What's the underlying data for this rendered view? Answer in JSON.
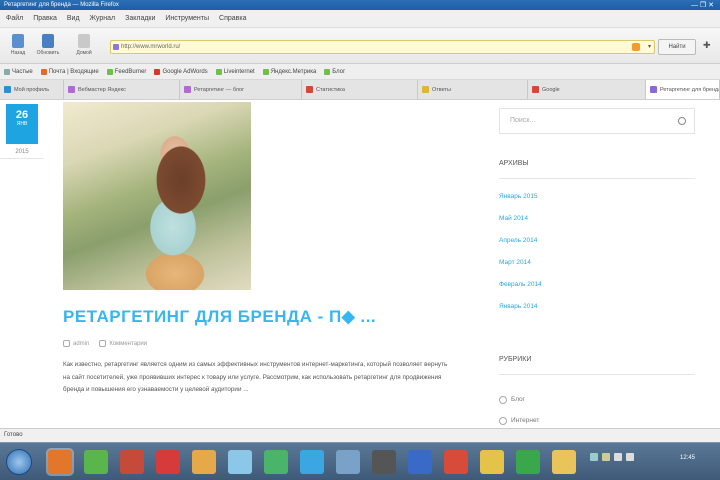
{
  "window": {
    "title": "Ретаргетинг для бренда — Mozilla Firefox",
    "controls": "— ❐ ✕"
  },
  "menu": [
    "Файл",
    "Правка",
    "Вид",
    "Журнал",
    "Закладки",
    "Инструменты",
    "Справка"
  ],
  "toolbar": {
    "buttons": [
      {
        "label": "Назад",
        "color": "#5a8fd0"
      },
      {
        "label": "Обновить",
        "color": "#4b7fc4"
      },
      {
        "label": "Домой",
        "color": "#c9c9c9"
      }
    ],
    "address_value": "http://www.mrworld.ru/",
    "go_label": "Найти",
    "extra_icon": "puzzle-icon"
  },
  "bookmarks": [
    {
      "label": "Частые",
      "color": "#8aa"
    },
    {
      "label": "Почта | Входящие",
      "color": "#e46a2a"
    },
    {
      "label": "FeedBurner",
      "color": "#6fbf4a"
    },
    {
      "label": "Google AdWords",
      "color": "#d63a2a"
    },
    {
      "label": "Liveinternet",
      "color": "#6fbf4a"
    },
    {
      "label": "Яндекс.Метрика",
      "color": "#6fbf4a"
    },
    {
      "label": "Блог",
      "color": "#6fbf4a"
    }
  ],
  "tabs": [
    {
      "label": "Мой профиль",
      "color": "#2a8fd8",
      "active": false
    },
    {
      "label": "Вебмастер Яндекс",
      "color": "#b06ad8",
      "active": false
    },
    {
      "label": "Ретаргетинг — блог",
      "color": "#b06ad8",
      "active": false
    },
    {
      "label": "Статистика",
      "color": "#d04a3a",
      "active": false
    },
    {
      "label": "Ответы",
      "color": "#e0b43a",
      "active": false
    },
    {
      "label": "Google",
      "color": "#d04a3a",
      "active": false
    },
    {
      "label": "Ретаргетинг для бренда",
      "color": "#8a6ad8",
      "active": true
    }
  ],
  "post": {
    "day": "26",
    "month": "ЯНВ",
    "year": "2015",
    "title": "РЕТАРГЕТИНГ ДЛЯ БРЕНДА - П◆ ...",
    "author": "admin",
    "comments": "Комментарии",
    "excerpt": "Как известно, ретаргетинг является одним из самых эффективных инструментов интернет-маркетинга, который позволяет вернуть на сайт посетителей, уже проявивших интерес к товару или услуге. Рассмотрим, как использовать ретаргетинг для продвижения бренда и повышения его узнаваемости у целевой аудитории ..."
  },
  "sidebar": {
    "search_placeholder": "Поиск...",
    "archive_title": "Архивы",
    "archive": [
      "Январь 2015",
      "Май 2014",
      "Апрель 2014",
      "Март 2014",
      "Февраль 2014",
      "Январь 2014"
    ],
    "categories_title": "Рубрики",
    "categories": [
      "Блог",
      "Интернет"
    ]
  },
  "status_text": "Готово",
  "taskbar": {
    "icons": [
      {
        "name": "firefox-icon",
        "color": "#e2762a"
      },
      {
        "name": "chrome-icon",
        "color": "#5ab54a"
      },
      {
        "name": "app-icon-3",
        "color": "#c64a3a"
      },
      {
        "name": "app-icon-4",
        "color": "#d63a3a"
      },
      {
        "name": "app-icon-5",
        "color": "#e5a94a"
      },
      {
        "name": "app-icon-6",
        "color": "#8cc7e8"
      },
      {
        "name": "app-icon-7",
        "color": "#4ab56a"
      },
      {
        "name": "skype-icon",
        "color": "#3aa7e3"
      },
      {
        "name": "app-icon-9",
        "color": "#7aa2c8"
      },
      {
        "name": "app-icon-10",
        "color": "#555"
      },
      {
        "name": "app-icon-11",
        "color": "#3a6ac8"
      },
      {
        "name": "app-icon-12",
        "color": "#d84a3a"
      },
      {
        "name": "app-icon-13",
        "color": "#e5c24a"
      },
      {
        "name": "app-icon-14",
        "color": "#3aa74a"
      },
      {
        "name": "folder-icon",
        "color": "#e8c45a"
      }
    ],
    "clock": "12:45"
  }
}
